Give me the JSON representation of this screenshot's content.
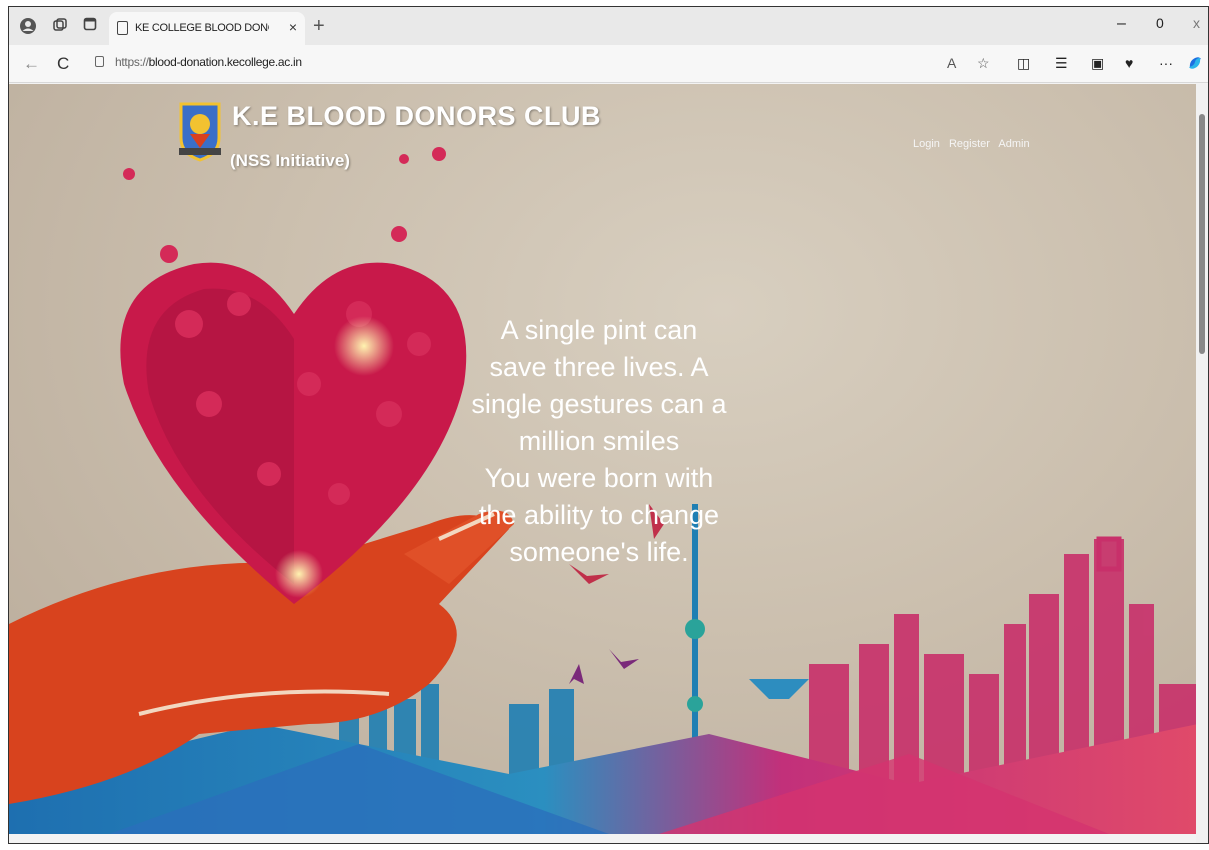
{
  "browser": {
    "tab_title": "KE COLLEGE BLOOD DONORS CL",
    "url_scheme": "https://",
    "url_host": "blood-donation.kecollege.ac.in",
    "window_controls": {
      "minimize": "–",
      "maximize": "▢",
      "close": "X"
    }
  },
  "site": {
    "title": "K.E BLOOD DONORS CLUB",
    "subtitle": "(NSS Initiative)",
    "nav": [
      "Login",
      "Register",
      "Admin"
    ]
  },
  "hero": {
    "quote_lines": [
      "A single pint can",
      "save three lives. A",
      "single gestures can a",
      "million smiles",
      "You were born with",
      "the ability to change",
      "someone's life."
    ]
  },
  "colors": {
    "heart": "#c8194a",
    "hand": "#d8401e",
    "city_pink": "#c52a6c",
    "city_blue": "#1e7fb0"
  }
}
